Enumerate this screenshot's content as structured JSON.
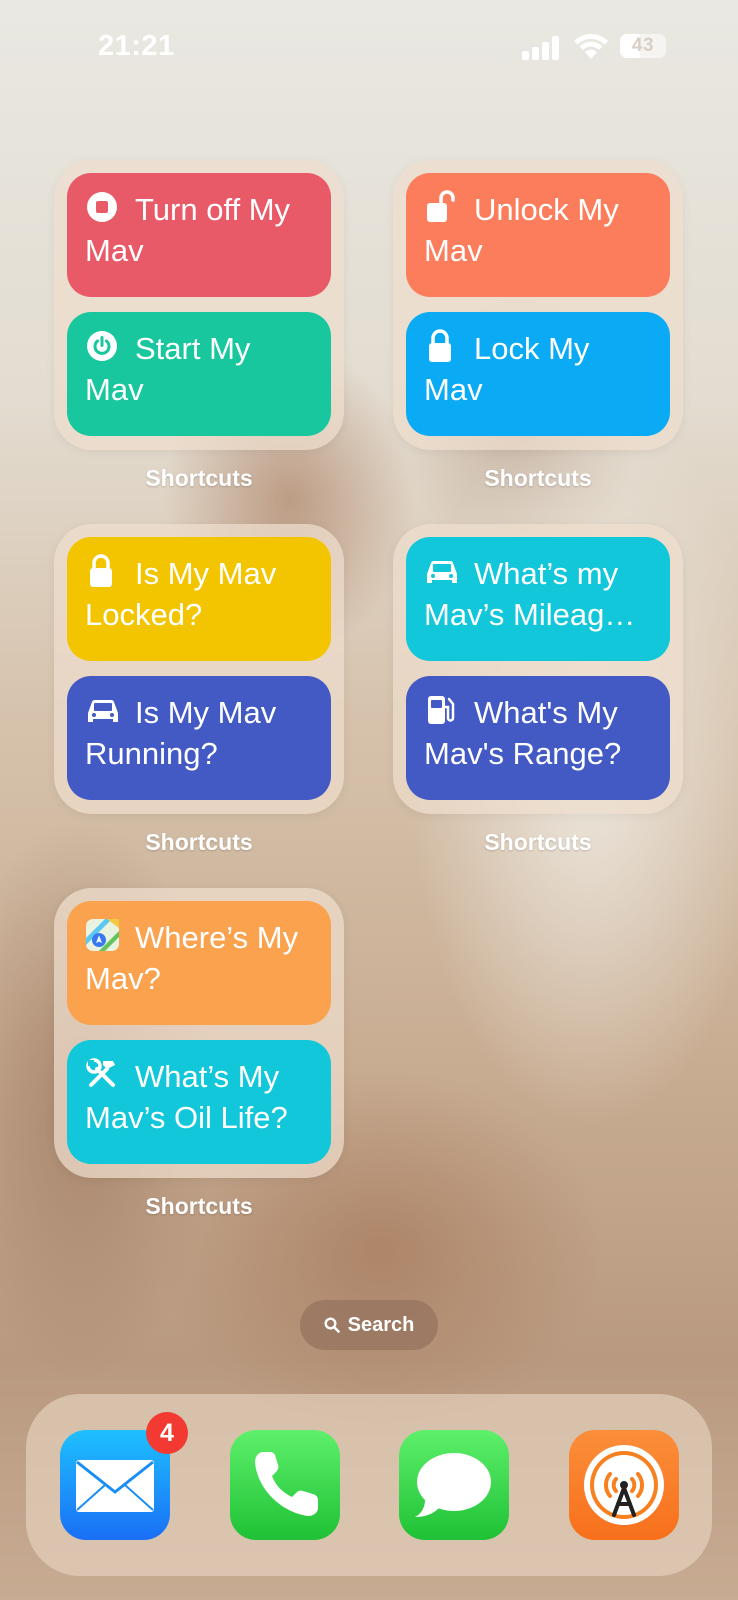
{
  "status_bar": {
    "time": "21:21",
    "battery": "43"
  },
  "widgets": [
    {
      "label": "Shortcuts",
      "tiles": [
        {
          "text": "Turn off My Mav",
          "icon": "stop-icon",
          "color": "#e85a68"
        },
        {
          "text": "Start My Mav",
          "icon": "power-icon",
          "color": "#18c79e"
        }
      ]
    },
    {
      "label": "Shortcuts",
      "tiles": [
        {
          "text": "Unlock My Mav",
          "icon": "unlock-icon",
          "color": "#fb7d5b"
        },
        {
          "text": "Lock My Mav",
          "icon": "lock-icon",
          "color": "#0baaf5"
        }
      ]
    },
    {
      "label": "Shortcuts",
      "tiles": [
        {
          "text": "Is My Mav Locked?",
          "icon": "lock-icon",
          "color": "#f2c500"
        },
        {
          "text": "Is My Mav Running?",
          "icon": "car-icon",
          "color": "#4359c4"
        }
      ]
    },
    {
      "label": "Shortcuts",
      "tiles": [
        {
          "text": "What’s my Mav’s Mileag…",
          "icon": "car-icon",
          "color": "#11c7d9"
        },
        {
          "text": "What's My Mav's Range?",
          "icon": "fuel-pump-icon",
          "color": "#4359c4"
        }
      ]
    },
    {
      "label": "Shortcuts",
      "tiles": [
        {
          "text": "Where’s My Mav?",
          "icon": "maps-icon",
          "color": "#fba24e"
        },
        {
          "text": "What’s My Mav’s Oil Life?",
          "icon": "tools-icon",
          "color": "#11c7d9"
        }
      ]
    }
  ],
  "search": {
    "label": "Search"
  },
  "dock": {
    "apps": [
      {
        "name": "Mail",
        "icon": "mail-icon",
        "badge": "4"
      },
      {
        "name": "Phone",
        "icon": "phone-icon"
      },
      {
        "name": "Messages",
        "icon": "messages-icon"
      },
      {
        "name": "Overcast",
        "icon": "overcast-icon"
      }
    ]
  }
}
